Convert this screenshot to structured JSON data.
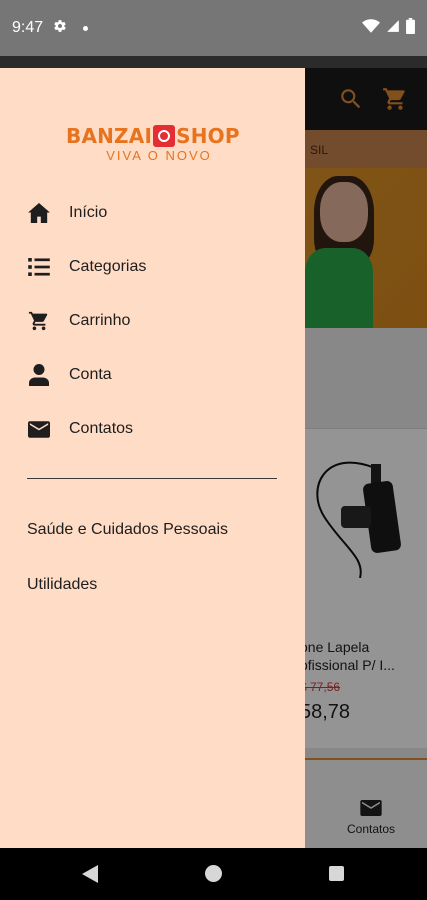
{
  "status_bar": {
    "time": "9:47",
    "icons": [
      "gear-icon",
      "dot-icon",
      "wifi-icon",
      "signal-icon",
      "battery-icon"
    ]
  },
  "background_app": {
    "header_icons": [
      "search-icon",
      "cart-icon"
    ],
    "promo_text": "SIL",
    "product": {
      "title_line1": "one Lapela",
      "title_line2": "ofissional P/ I...",
      "old_price": "$ 77,56",
      "price": "58,78"
    },
    "bottom_nav": {
      "contacts_label": "Contatos"
    }
  },
  "drawer": {
    "logo": {
      "left": "BANZAI",
      "right": "SHOP",
      "tagline": "VIVA O NOVO"
    },
    "menu": [
      {
        "label": "Início",
        "icon": "home-icon"
      },
      {
        "label": "Categorias",
        "icon": "list-icon"
      },
      {
        "label": "Carrinho",
        "icon": "cart-icon"
      },
      {
        "label": "Conta",
        "icon": "person-icon"
      },
      {
        "label": "Contatos",
        "icon": "envelope-icon"
      }
    ],
    "categories": [
      {
        "label": "Saúde e Cuidados Pessoais"
      },
      {
        "label": "Utilidades"
      }
    ]
  },
  "colors": {
    "drawer_bg": "#ffdcc5",
    "brand_orange": "#e7731e",
    "brand_red": "#e52d34",
    "accent_orange": "#e28a2f"
  }
}
